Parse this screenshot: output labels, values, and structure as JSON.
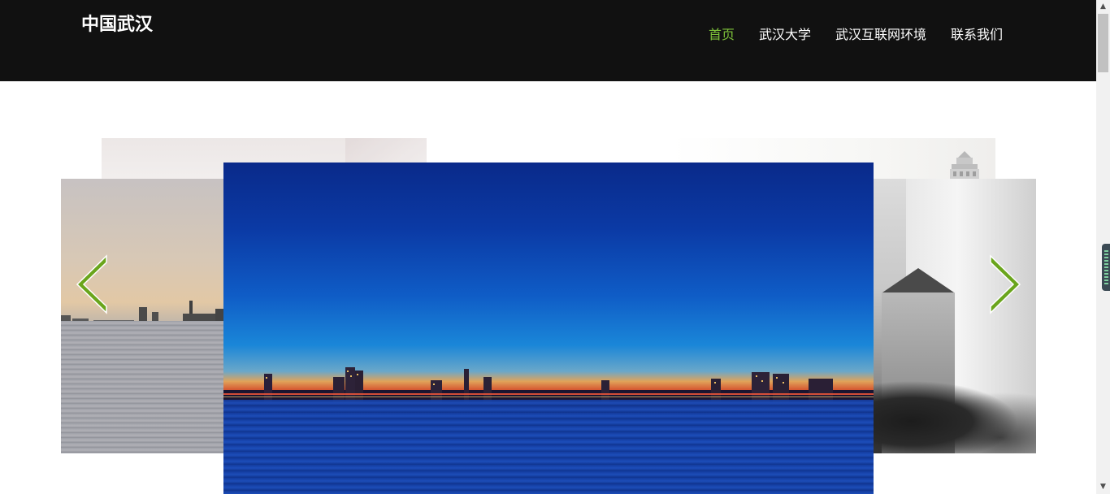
{
  "header": {
    "logo": "中国武汉",
    "nav": [
      {
        "label": "首页",
        "active": true
      },
      {
        "label": "武汉大学",
        "active": false
      },
      {
        "label": "武汉互联网环境",
        "active": false
      },
      {
        "label": "联系我们",
        "active": false
      }
    ]
  },
  "carousel": {
    "prev_icon": "chevron-left-icon",
    "next_icon": "chevron-right-icon",
    "arrow_color": "#6aa51c"
  },
  "colors": {
    "header_bg": "#111111",
    "nav_active": "#7ec33a",
    "nav_text": "#ffffff"
  },
  "scrollbar": {
    "up_icon": "▲",
    "down_icon": "▼"
  }
}
